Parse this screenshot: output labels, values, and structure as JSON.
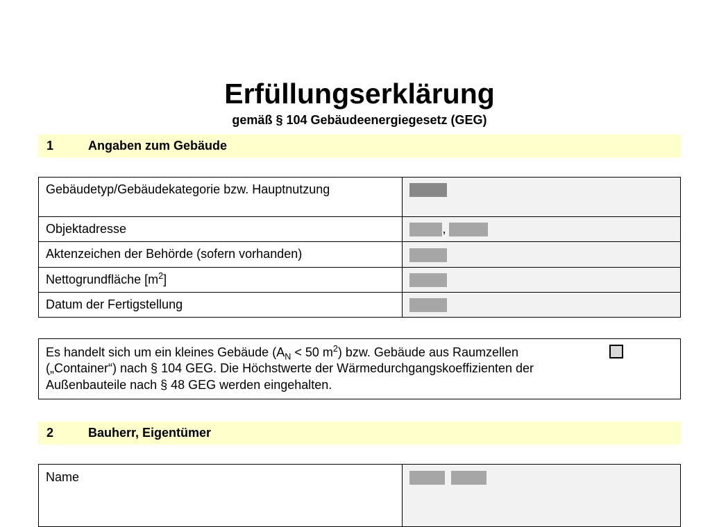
{
  "header": {
    "title": "Erfüllungserklärung",
    "subtitle": "gemäß § 104 Gebäudeenergiegesetz (GEG)"
  },
  "section1": {
    "num": "1",
    "title": "Angaben zum Gebäude",
    "rows": {
      "gebaeudetyp_label": "Gebäudetyp/Gebäudekategorie bzw. Hauptnutzung",
      "objektadresse_label": "Objektadresse",
      "aktenzeichen_label": "Aktenzeichen der Behörde (sofern vorhanden)",
      "nettogrundflaeche_label_pre": "Nettogrundfläche [m",
      "nettogrundflaeche_label_post": "]",
      "datum_label": "Datum der Fertigstellung"
    },
    "values": {
      "gebaeudetyp": "",
      "objektadresse": ", ",
      "aktenzeichen": "",
      "nettogrundflaeche": "",
      "datum": ""
    }
  },
  "small_building": {
    "text_pre": "Es handelt sich um ein kleines Gebäude (A",
    "text_mid1": " < 50 m",
    "text_mid2": ") bzw. Gebäude aus Raumzellen („Container“) nach § 104 GEG. Die Höchstwerte der Wärmedurch­gangskoeffizienten der Außenbauteile nach § 48 GEG werden eingehalten.",
    "checked": false
  },
  "section2": {
    "num": "2",
    "title": "Bauherr, Eigentümer",
    "name_label": "Name",
    "name_value": ""
  }
}
